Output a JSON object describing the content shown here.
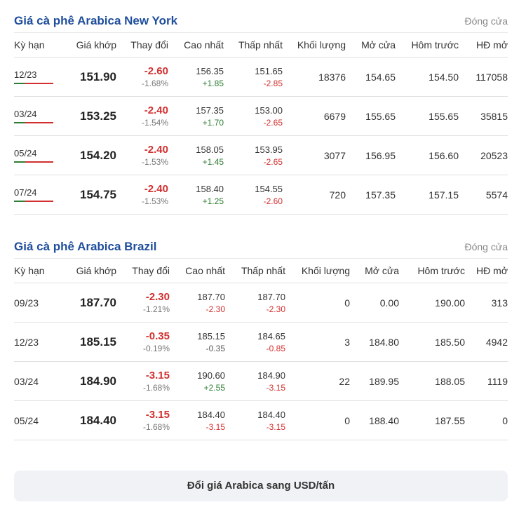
{
  "ny": {
    "title": "Giá cà phê Arabica New York",
    "status": "Đóng cửa",
    "headers": [
      "Kỳ hạn",
      "Giá khớp",
      "Thay đổi",
      "Cao nhất",
      "Thấp nhất",
      "Khối lượng",
      "Mở cửa",
      "Hôm trước",
      "HĐ mở"
    ],
    "rows": [
      {
        "term": "12/23",
        "price": "151.90",
        "change": "-2.60",
        "change_pct": "-1.68%",
        "high": "156.35",
        "high_chg": "+1.85",
        "low": "151.65",
        "low_chg": "-2.85",
        "volume": "18376",
        "open": "154.65",
        "prev": "154.50",
        "oi": "117058"
      },
      {
        "term": "03/24",
        "price": "153.25",
        "change": "-2.40",
        "change_pct": "-1.54%",
        "high": "157.35",
        "high_chg": "+1.70",
        "low": "153.00",
        "low_chg": "-2.65",
        "volume": "6679",
        "open": "155.65",
        "prev": "155.65",
        "oi": "35815"
      },
      {
        "term": "05/24",
        "price": "154.20",
        "change": "-2.40",
        "change_pct": "-1.53%",
        "high": "158.05",
        "high_chg": "+1.45",
        "low": "153.95",
        "low_chg": "-2.65",
        "volume": "3077",
        "open": "156.95",
        "prev": "156.60",
        "oi": "20523"
      },
      {
        "term": "07/24",
        "price": "154.75",
        "change": "-2.40",
        "change_pct": "-1.53%",
        "high": "158.40",
        "high_chg": "+1.25",
        "low": "154.55",
        "low_chg": "-2.60",
        "volume": "720",
        "open": "157.35",
        "prev": "157.15",
        "oi": "5574"
      }
    ]
  },
  "br": {
    "title": "Giá cà phê Arabica Brazil",
    "status": "Đóng cửa",
    "headers": [
      "Kỳ hạn",
      "Giá khớp",
      "Thay đổi",
      "Cao nhất",
      "Thấp nhất",
      "Khối lượng",
      "Mở cửa",
      "Hôm trước",
      "HĐ mở"
    ],
    "rows": [
      {
        "term": "09/23",
        "price": "187.70",
        "change": "-2.30",
        "change_pct": "-1.21%",
        "high": "187.70",
        "high_chg": "-2.30",
        "high_dir": "down",
        "low": "187.70",
        "low_chg": "-2.30",
        "volume": "0",
        "open": "0.00",
        "prev": "190.00",
        "oi": "313"
      },
      {
        "term": "12/23",
        "price": "185.15",
        "change": "-0.35",
        "change_pct": "-0.19%",
        "high": "185.15",
        "high_chg": "-0.35",
        "high_dir": "neutral",
        "low": "184.65",
        "low_chg": "-0.85",
        "volume": "3",
        "open": "184.80",
        "prev": "185.50",
        "oi": "4942"
      },
      {
        "term": "03/24",
        "price": "184.90",
        "change": "-3.15",
        "change_pct": "-1.68%",
        "high": "190.60",
        "high_chg": "+2.55",
        "high_dir": "up",
        "low": "184.90",
        "low_chg": "-3.15",
        "volume": "22",
        "open": "189.95",
        "prev": "188.05",
        "oi": "1119"
      },
      {
        "term": "05/24",
        "price": "184.40",
        "change": "-3.15",
        "change_pct": "-1.68%",
        "high": "184.40",
        "high_chg": "-3.15",
        "high_dir": "down",
        "low": "184.40",
        "low_chg": "-3.15",
        "volume": "0",
        "open": "188.40",
        "prev": "187.55",
        "oi": "0"
      }
    ]
  },
  "cta": {
    "label": "Đổi giá Arabica sang USD/tấn"
  },
  "colors": {
    "title": "#1f4e9c",
    "up": "#2e7d32",
    "down": "#d32f2f",
    "button_bg": "#f0f2f5"
  }
}
